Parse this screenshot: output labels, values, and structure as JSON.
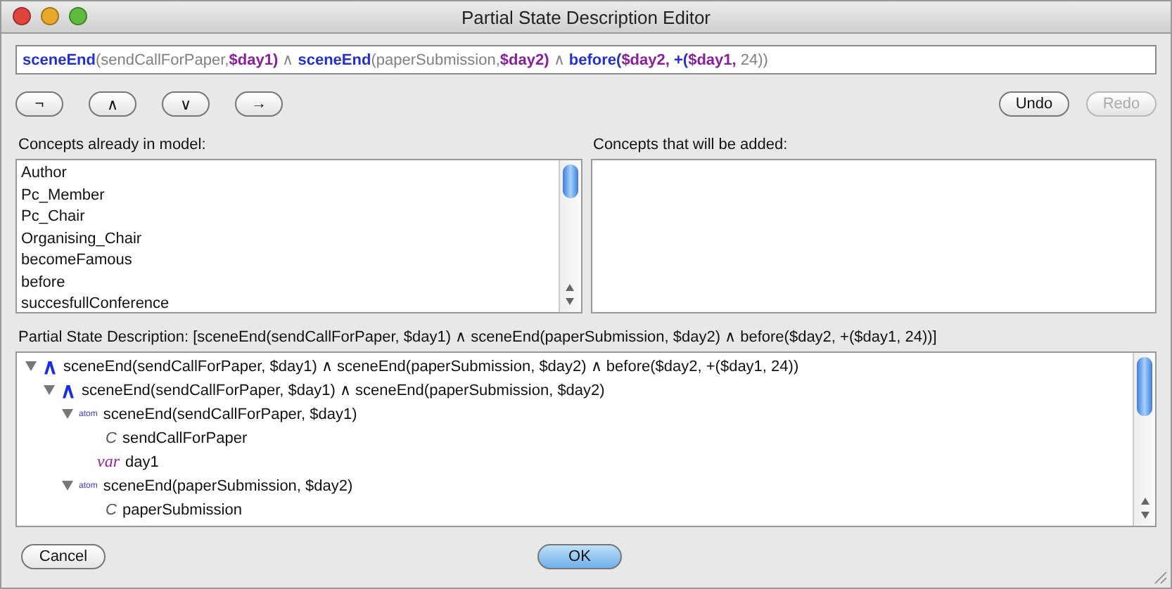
{
  "window": {
    "title": "Partial State Description Editor"
  },
  "formula": [
    {
      "text": "sceneEnd",
      "kind": "func"
    },
    {
      "text": "(sendCallForPaper,",
      "kind": "arg"
    },
    {
      "text": "$day1)",
      "kind": "var"
    },
    {
      "text": " ∧ ",
      "kind": "op"
    },
    {
      "text": "sceneEnd",
      "kind": "func"
    },
    {
      "text": "(paperSubmission,",
      "kind": "arg"
    },
    {
      "text": "$day2)",
      "kind": "var"
    },
    {
      "text": " ∧ ",
      "kind": "op"
    },
    {
      "text": "before(",
      "kind": "func"
    },
    {
      "text": "$day2,",
      "kind": "var"
    },
    {
      "text": " +(",
      "kind": "func"
    },
    {
      "text": "$day1,",
      "kind": "var"
    },
    {
      "text": " 24))",
      "kind": "arg"
    }
  ],
  "operators": [
    "¬",
    "∧",
    "∨",
    "→"
  ],
  "history_buttons": [
    {
      "label": "Undo",
      "disabled": false
    },
    {
      "label": "Redo",
      "disabled": true
    }
  ],
  "concepts_in_model": {
    "label": "Concepts already in model:",
    "items": [
      "Author",
      "Pc_Member",
      "Pc_Chair",
      "Organising_Chair",
      "becomeFamous",
      "before",
      "succesfullConference"
    ]
  },
  "concepts_to_add": {
    "label": "Concepts that will be added:"
  },
  "description": {
    "label": "Partial State Description: [sceneEnd(sendCallForPaper, $day1) ∧ sceneEnd(paperSubmission, $day2) ∧ before($day2, +($day1, 24))]"
  },
  "tree": [
    {
      "kind": "and",
      "badge": "∧",
      "label": "sceneEnd(sendCallForPaper, $day1) ∧ sceneEnd(paperSubmission, $day2) ∧ before($day2, +($day1, 24))",
      "expanded": true,
      "children": [
        {
          "kind": "and",
          "badge": "∧",
          "label": "sceneEnd(sendCallForPaper, $day1) ∧ sceneEnd(paperSubmission, $day2)",
          "expanded": true,
          "children": [
            {
              "kind": "atom",
              "badge": "atom",
              "label": "sceneEnd(sendCallForPaper, $day1)",
              "expanded": true,
              "children": [
                {
                  "kind": "concept",
                  "badge": "C",
                  "label": "sendCallForPaper"
                },
                {
                  "kind": "var",
                  "badge": "var",
                  "label": "day1"
                }
              ]
            },
            {
              "kind": "atom",
              "badge": "atom",
              "label": "sceneEnd(paperSubmission, $day2)",
              "expanded": true,
              "children": [
                {
                  "kind": "concept",
                  "badge": "C",
                  "label": "paperSubmission"
                }
              ]
            }
          ]
        }
      ]
    }
  ],
  "footer_buttons": [
    {
      "label": "Cancel",
      "default": false
    },
    {
      "label": "OK",
      "default": true
    }
  ]
}
